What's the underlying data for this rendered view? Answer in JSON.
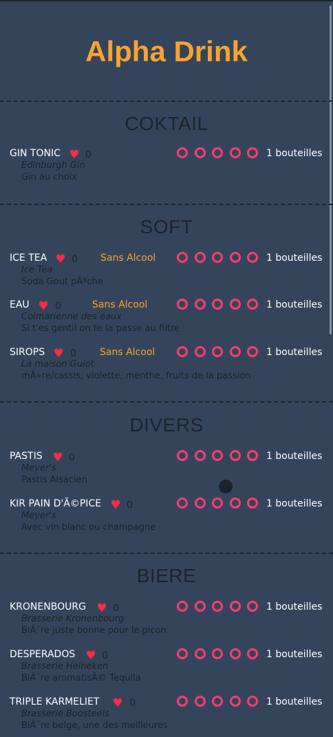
{
  "app": {
    "title": "Alpha Drink"
  },
  "sections": [
    {
      "title": "COKTAIL",
      "items": [
        {
          "name": "GIN TONIC",
          "likes": "0",
          "tag": "",
          "bottles": "1 bouteilles",
          "brand": "Edinburgh Gin",
          "desc": "Gin au choix"
        }
      ]
    },
    {
      "title": "SOFT",
      "items": [
        {
          "name": "ICE TEA",
          "likes": "0",
          "tag": "Sans Alcool",
          "bottles": "1 bouteilles",
          "brand": "Ice Tea",
          "desc": "Soda Gout pÃªche"
        },
        {
          "name": "EAU",
          "likes": "0",
          "tag": "Sans Alcool",
          "bottles": "1 bouteilles",
          "brand": "Colmarienne des eaux",
          "desc": "Si t'es gentil on te la passe au filtre"
        },
        {
          "name": "SIROPS",
          "likes": "0",
          "tag": "Sans Alcool",
          "bottles": "1 bouteilles",
          "brand": "La maison Guiot",
          "desc": "mÃ»re/cassis, violette, menthe, fruits de la passion"
        }
      ]
    },
    {
      "title": "DIVERS",
      "items": [
        {
          "name": "PASTIS",
          "likes": "0",
          "tag": "",
          "bottles": "1 bouteilles",
          "brand": "Meyer's",
          "desc": "Pastis Alsacien"
        },
        {
          "name": "KIR PAIN D'Ã©PICE",
          "likes": "0",
          "tag": "",
          "bottles": "1 bouteilles",
          "brand": "Meyer's",
          "desc": "Avec vin blanc ou champagne"
        }
      ]
    },
    {
      "title": "BIERE",
      "items": [
        {
          "name": "KRONENBOURG",
          "likes": "0",
          "tag": "",
          "bottles": "1 bouteilles",
          "brand": "Brasserie Kronenbourg",
          "desc": "BiÃ¨re juste bonne pour le picon"
        },
        {
          "name": "DESPERADOS",
          "likes": "0",
          "tag": "",
          "bottles": "1 bouteilles",
          "brand": "Brasserie Heineken",
          "desc": "BiÃ¨re aromatisÃ© Tequila"
        },
        {
          "name": "TRIPLE KARMELIET",
          "likes": "0",
          "tag": "",
          "bottles": "1 bouteilles",
          "brand": "Brasserie Boosteels",
          "desc": "BiÃ¨re belge, une des meilleures"
        }
      ]
    }
  ],
  "icons": {
    "like": "heart-icon",
    "bottle_slot": "circle-icon"
  },
  "colors": {
    "background": "#34455b",
    "accent": "#f7a331",
    "heart": "#ff2a46",
    "circle": "#ff3d6b",
    "dark_text": "#1c232c"
  }
}
